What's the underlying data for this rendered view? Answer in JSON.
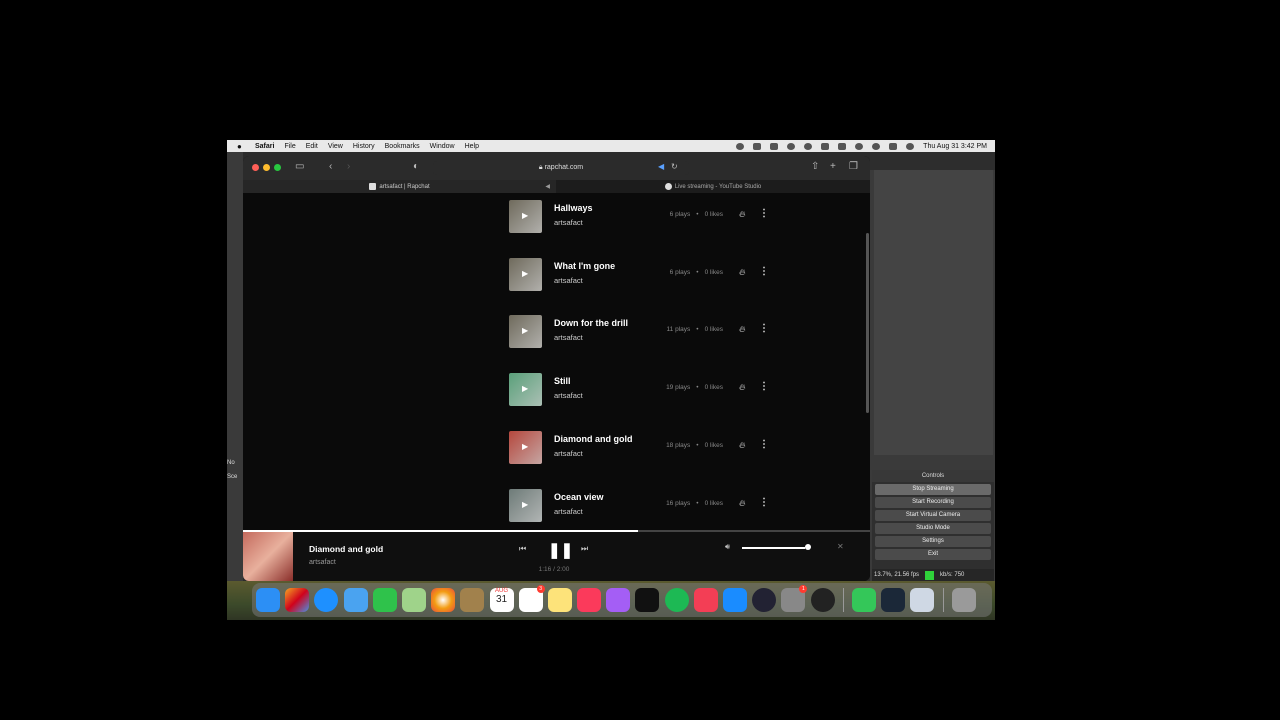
{
  "menubar": {
    "app": "Safari",
    "items": [
      "File",
      "Edit",
      "View",
      "History",
      "Bookmarks",
      "Window",
      "Help"
    ],
    "clock": "Thu Aug 31  3:42 PM"
  },
  "browser": {
    "url": "rapchat.com",
    "tabs": [
      {
        "label": "artsafact | Rapchat",
        "icon": "rapchat-favicon"
      },
      {
        "label": "Live streaming - YouTube Studio",
        "icon": "youtube-studio-favicon"
      }
    ]
  },
  "tracks": [
    {
      "title": "Hallways",
      "artist": "artsafact",
      "plays": "6 plays",
      "likes": "0 likes",
      "thumb": "#6f6a5c"
    },
    {
      "title": "What I'm gone",
      "artist": "artsafact",
      "plays": "6 plays",
      "likes": "0 likes",
      "thumb": "#6f6a5c"
    },
    {
      "title": "Down for the drill",
      "artist": "artsafact",
      "plays": "11 plays",
      "likes": "0 likes",
      "thumb": "#6f6a5c"
    },
    {
      "title": "Still",
      "artist": "artsafact",
      "plays": "19 plays",
      "likes": "0 likes",
      "thumb": "#5aa07a"
    },
    {
      "title": "Diamond and gold",
      "artist": "artsafact",
      "plays": "18 plays",
      "likes": "0 likes",
      "thumb": "#b5473d"
    },
    {
      "title": "Ocean view",
      "artist": "artsafact",
      "plays": "16 plays",
      "likes": "0 likes",
      "thumb": "#6e7b78"
    }
  ],
  "stat_separator": "•",
  "player": {
    "title": "Diamond and gold",
    "artist": "artsafact",
    "time": "1:16 / 2:00",
    "progress_fraction": 0.63,
    "volume_fraction": 0.95
  },
  "obs": {
    "side_label_1": "No",
    "side_label_2": "Sce",
    "controls_header": "Controls",
    "buttons": [
      "Stop Streaming",
      "Start Recording",
      "Start Virtual Camera",
      "Studio Mode",
      "Settings",
      "Exit"
    ],
    "status": "13.7%, 21.56 fps",
    "kbps": "kb/s: 750"
  },
  "dock": {
    "calendar_month": "AUG",
    "calendar_day": "31",
    "badge_reminders": "3",
    "badge_settings": "1"
  },
  "colors": {
    "background": "#0a0a0a",
    "accent": "#ffffff",
    "obs_status": "#2fd13a"
  }
}
